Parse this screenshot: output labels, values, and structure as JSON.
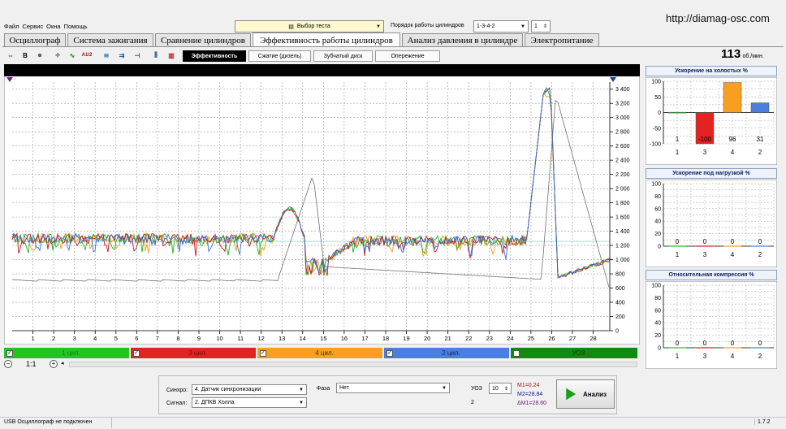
{
  "menu": [
    "Файл",
    "Сервис",
    "Окна",
    "Помощь"
  ],
  "test_select": {
    "label": "Выбор теста"
  },
  "order": {
    "label": "Порядок работы цилиндров",
    "value": "1-3-4-2",
    "number": "1"
  },
  "url": "http://diamag-osc.com",
  "tabs": [
    "Осциллограф",
    "Система зажигания",
    "Сравнение цилиндров",
    "Эффективность работы цилиндров",
    "Анализ давления в цилиндре",
    "Электропитание"
  ],
  "toolbar_icons": [
    "cursor-icon",
    "bold-b-icon",
    "rpm-icon",
    "axis-scale-icon",
    "waveform-icon",
    "math-icon",
    "grid-icon",
    "layers-icon",
    "time-icon",
    "cut-icon",
    "bars-icon",
    "histogram-icon"
  ],
  "toolbar_texts": [
    "",
    "B",
    "RPM",
    "",
    "",
    "A1/2",
    "",
    "",
    "",
    "",
    "",
    ""
  ],
  "subtabs": [
    "Эффективность",
    "Сжатие (дизель)",
    "Зубчатый диск",
    "Опережение"
  ],
  "rpm": {
    "value": "113",
    "unit": "об./мин."
  },
  "chart": {
    "y_ticks": [
      "3 400",
      "3 200",
      "3 000",
      "2 800",
      "2 600",
      "2 400",
      "2 200",
      "2 000",
      "1 800",
      "1 600",
      "1 400",
      "1 200",
      "1 000",
      "800",
      "600",
      "400",
      "200",
      "0"
    ],
    "x_ticks": [
      "1",
      "2",
      "3",
      "4",
      "5",
      "6",
      "7",
      "8",
      "9",
      "10",
      "11",
      "12",
      "13",
      "14",
      "15",
      "16",
      "17",
      "18",
      "19",
      "20",
      "21",
      "22",
      "23",
      "24",
      "25",
      "26",
      "27",
      "28"
    ]
  },
  "cylinders": [
    {
      "label": "1 цил.",
      "color": "#22c422",
      "text": "#118011",
      "checked": "✓"
    },
    {
      "label": "3 цил.",
      "color": "#e32222",
      "text": "#7a0a0a",
      "checked": "✓"
    },
    {
      "label": "4 цил.",
      "color": "#f7a020",
      "text": "#503000",
      "checked": "✓"
    },
    {
      "label": "2 цил.",
      "color": "#4a7fe0",
      "text": "#102860",
      "checked": "✓"
    },
    {
      "label": "УОЗ",
      "color": "#128a12",
      "text": "#0a400a",
      "checked": ""
    }
  ],
  "zoom": {
    "value": "1:1"
  },
  "panels": [
    {
      "title": "Ускорение на холостых %",
      "y_ticks": [
        "100",
        "50",
        "0",
        "-50",
        "-100"
      ],
      "cylinders": [
        "1",
        "3",
        "4",
        "2"
      ],
      "values": [
        "1",
        "-100",
        "96",
        "31"
      ],
      "nums": [
        1,
        -100,
        96,
        31
      ]
    },
    {
      "title": "Ускорение под нагрузкой %",
      "y_ticks": [
        "100",
        "80",
        "60",
        "40",
        "20",
        "0"
      ],
      "cylinders": [
        "1",
        "3",
        "4",
        "2"
      ],
      "values": [
        "0",
        "0",
        "0",
        "0"
      ],
      "nums": [
        0,
        0,
        0,
        0
      ]
    },
    {
      "title": "Относительная компрессия %",
      "y_ticks": [
        "100",
        "80",
        "60",
        "40",
        "20",
        "0"
      ],
      "cylinders": [
        "1",
        "3",
        "4",
        "2"
      ],
      "values": [
        "0",
        "0",
        "0",
        "0"
      ],
      "nums": [
        0,
        0,
        0,
        0
      ]
    }
  ],
  "controls": {
    "sync_label": "Синхро:",
    "sync_value": "4. Датчик синхронизации",
    "signal_label": "Сигнал:",
    "signal_value": "2. ДПКВ Холла",
    "phase_label": "Фаза",
    "phase_value": "Нет",
    "uoz_label": "УОЗ",
    "uoz_value": "10",
    "uoz_sub": "2",
    "m1": "M1=0.24",
    "m2": "M2=28.84",
    "dm": "ΔM1=28.60",
    "analyze": "Анализ"
  },
  "status": {
    "left": "USB Осциллограф не подключен",
    "version": "1.7.2"
  }
}
